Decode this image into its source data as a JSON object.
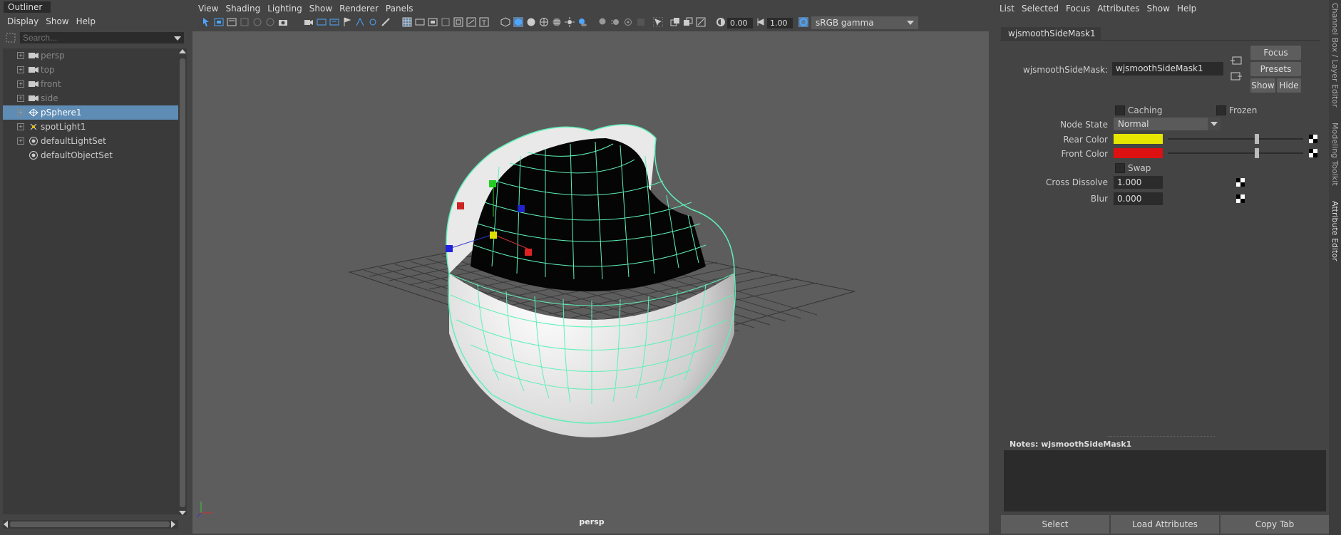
{
  "outliner": {
    "title": "Outliner",
    "menu": [
      "Display",
      "Show",
      "Help"
    ],
    "search_placeholder": "Search...",
    "items": [
      {
        "label": "persp",
        "icon": "camera-icon",
        "dim": true,
        "expandable": true
      },
      {
        "label": "top",
        "icon": "camera-icon",
        "dim": true,
        "expandable": true
      },
      {
        "label": "front",
        "icon": "camera-icon",
        "dim": true,
        "expandable": true
      },
      {
        "label": "side",
        "icon": "camera-icon",
        "dim": true,
        "expandable": true
      },
      {
        "label": "pSphere1",
        "icon": "mesh-icon",
        "selected": true,
        "expandable": true
      },
      {
        "label": "spotLight1",
        "icon": "spotlight-icon",
        "expandable": true
      },
      {
        "label": "defaultLightSet",
        "icon": "set-icon",
        "expandable": true
      },
      {
        "label": "defaultObjectSet",
        "icon": "set-icon",
        "expandable": false
      }
    ]
  },
  "viewport": {
    "menu": [
      "View",
      "Shading",
      "Lighting",
      "Show",
      "Renderer",
      "Panels"
    ],
    "exposure": "0.00",
    "gamma": "1.00",
    "color_space": "sRGB gamma",
    "camera_label": "persp"
  },
  "attribute_editor": {
    "menu": [
      "List",
      "Selected",
      "Focus",
      "Attributes",
      "Show",
      "Help"
    ],
    "node_tab": "wjsmoothSideMask1",
    "node_label": "wjsmoothSideMask:",
    "node_value": "wjsmoothSideMask1",
    "buttons": {
      "focus": "Focus",
      "presets": "Presets",
      "show": "Show",
      "hide": "Hide"
    },
    "caching_label": "Caching",
    "frozen_label": "Frozen",
    "node_state_label": "Node State",
    "node_state_value": "Normal",
    "rear_color_label": "Rear Color",
    "rear_color": "#e6e600",
    "front_color_label": "Front Color",
    "front_color": "#dd1111",
    "swap_label": "Swap",
    "cross_dissolve_label": "Cross Dissolve",
    "cross_dissolve_value": "1.000",
    "blur_label": "Blur",
    "blur_value": "0.000",
    "notes_label": "Notes:  wjsmoothSideMask1",
    "bottom_buttons": [
      "Select",
      "Load Attributes",
      "Copy Tab"
    ]
  },
  "side_tabs": [
    "Channel Box / Layer Editor",
    "Modeling Toolkit",
    "Attribute Editor"
  ]
}
